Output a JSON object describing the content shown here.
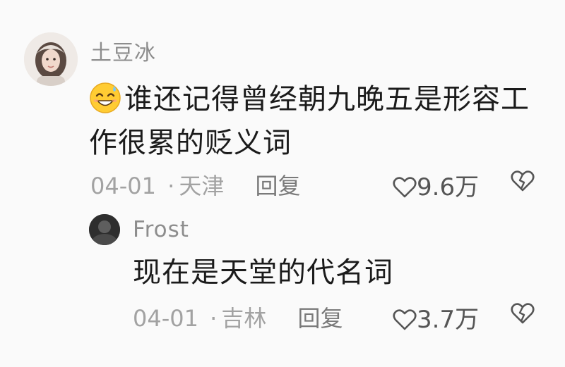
{
  "comments": [
    {
      "username": "土豆冰",
      "emoji_icon": "smiling-sweat-emoji",
      "text_line1": "谁还记得曾经朝九晚五是形容工",
      "text_line2": "作很累的贬义词",
      "date": "04-01",
      "separator": "·",
      "location": "天津",
      "reply_label": "回复",
      "likes": "9.6万"
    }
  ],
  "replies": [
    {
      "username": "Frost",
      "text": "现在是天堂的代名词",
      "date": "04-01",
      "separator": "·",
      "location": "吉林",
      "reply_label": "回复",
      "likes": "3.7万"
    }
  ],
  "colors": {
    "text_primary": "#1b1b1b",
    "text_secondary": "#8d8d8d",
    "meta": "#a2a2a2",
    "background": "#fafafa"
  }
}
